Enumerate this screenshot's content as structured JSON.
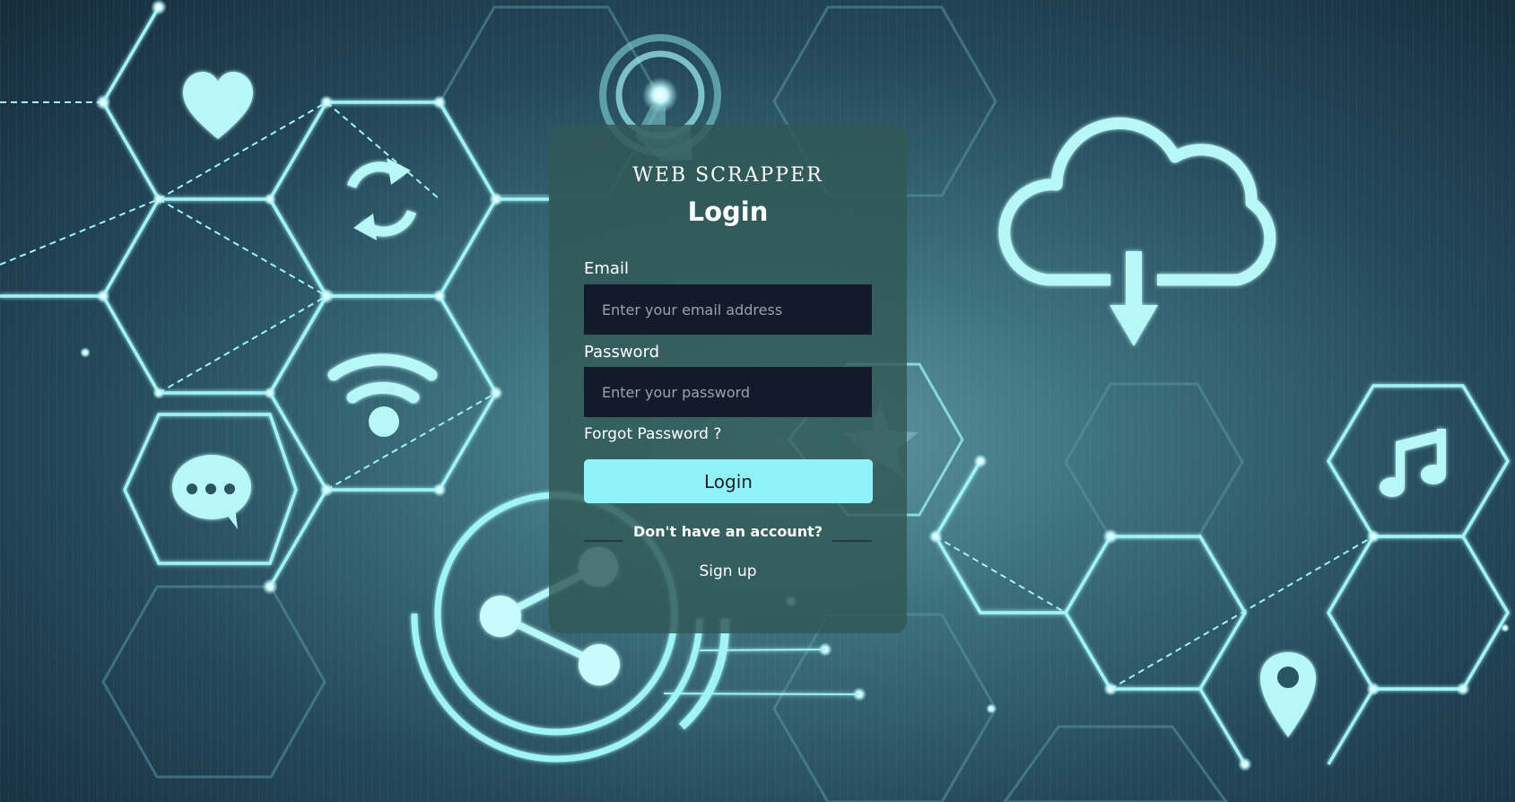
{
  "brand": {
    "name": "WEB SCRAPPER"
  },
  "login": {
    "title": "Login",
    "email_label": "Email",
    "email_placeholder": "Enter your email address",
    "password_label": "Password",
    "password_placeholder": "Enter your password",
    "forgot_password": "Forgot Password ?",
    "submit_label": "Login",
    "signup_prompt": "Don't have an account?",
    "signup_link": "Sign up"
  },
  "background": {
    "icons": [
      "heart-icon",
      "refresh-icon",
      "wifi-icon",
      "chat-icon",
      "touch-icon",
      "cloud-download-icon",
      "star-icon",
      "music-icon",
      "location-pin-icon",
      "share-icon"
    ]
  },
  "colors": {
    "accent": "#8ef3f6",
    "card": "#2f5854",
    "input_bg": "#131a29",
    "glow": "#9ff4f5"
  }
}
